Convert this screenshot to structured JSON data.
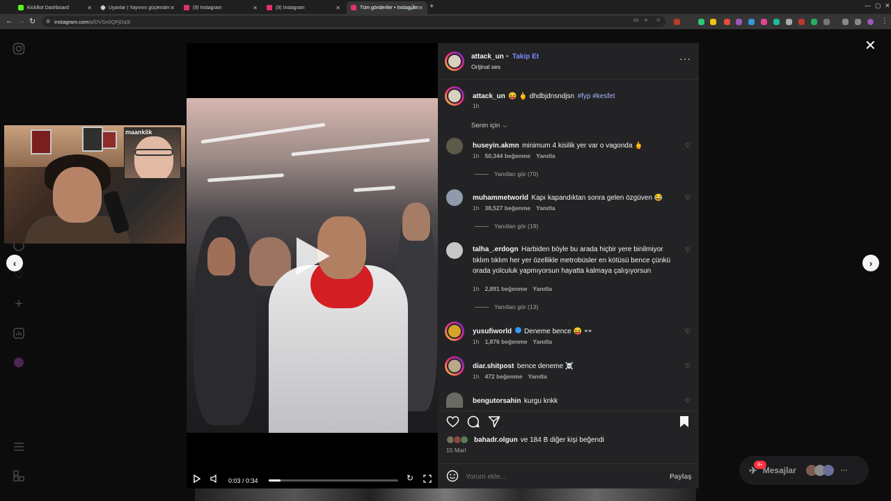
{
  "browser": {
    "tabs": [
      {
        "title": "KickBot Dashboard",
        "color": "#53fc18",
        "active": false
      },
      {
        "title": "Uyarılar | Yayınını güçlendirmek",
        "color": "#cccccc",
        "active": false
      },
      {
        "title": "(9) Instagram",
        "color": "#e1306c",
        "active": false
      },
      {
        "title": "(9) Instagram",
        "color": "#e1306c",
        "active": false
      },
      {
        "title": "Tüm gönderiler • Instagram",
        "color": "#e1306c",
        "active": true
      }
    ],
    "url_host": "instagram.com",
    "url_path": "/p/DVSn0QFjDq3/"
  },
  "webcam": {
    "guest_name": "maanklik"
  },
  "video": {
    "time": "0:03 / 0:34",
    "progress": 0.09
  },
  "post": {
    "author": "attack_un",
    "follow_label": "Takip Et",
    "audio": "Orijinal ses",
    "caption_text": "😝 🖕 dhdbjdnsndjsn",
    "caption_tags": "#fyp #kesfet",
    "caption_time": "1h",
    "sort_label": "Senin için",
    "comments": [
      {
        "user": "huseyin.akmn",
        "text": "minimum 4 kisilik yer var o vagonda 🖕",
        "time": "1h",
        "likes": "50,344 beğenme",
        "reply": "Yanıtla",
        "replies": "Yanıtları gör (70)",
        "avatar": "#5b5a48"
      },
      {
        "user": "muhammetworld",
        "text": "Kapı kapandıktan sonra gelen özgüven 😂",
        "time": "1h",
        "likes": "38,527 beğenme",
        "reply": "Yanıtla",
        "replies": "Yanıtları gör (19)",
        "avatar": "#8f9baa"
      },
      {
        "user": "talha_.erdogn",
        "text": "Harbiden böyle bu arada hiçbir yere binilmiyor tıklım tıklım her yer özellikle metrobüsler en kötüsü bence çünkü orada yolculuk yapmıyorsun hayatta kalmaya çalışıyorsun",
        "time": "1h",
        "likes": "2,891 beğenme",
        "reply": "Yanıtla",
        "replies": "Yanıtları gör (13)",
        "avatar": "#c7c7c7"
      },
      {
        "user": "yusufiworld",
        "text": "Deneme bence 😝 👓",
        "time": "1h",
        "likes": "1,876 beğenme",
        "reply": "Yanıtla",
        "avatar": "#d5a326"
      },
      {
        "user": "diar.shitpost",
        "text": "bence deneme ☠️",
        "time": "1h",
        "likes": "472 beğenme",
        "reply": "Yanıtla",
        "avatar": "#b9a98a"
      },
      {
        "user": "bengutorsahin",
        "text": "kurgu knkk",
        "avatar": "#6a6a62"
      }
    ],
    "liked_by_user": "bahadr.olgun",
    "liked_by_rest": "ve 184 B diğer kişi beğendi",
    "date": "15 Mart",
    "comment_placeholder": "Yorum ekle...",
    "share_label": "Paylaş"
  },
  "messages": {
    "label": "Mesajlar",
    "badge": "9+"
  },
  "colors": {
    "ig_bg": "#0c0c0c",
    "panel": "#232325",
    "link": "#7b8cff",
    "badge": "#ff3040"
  }
}
